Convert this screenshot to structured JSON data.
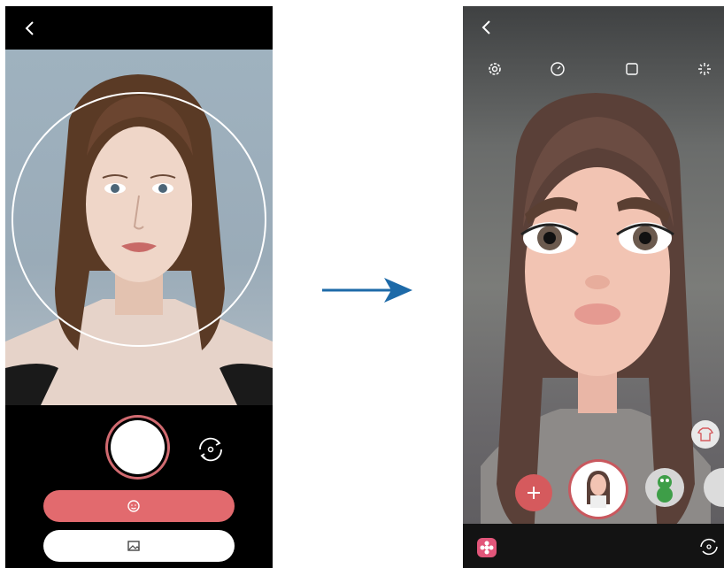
{
  "left_screen": {
    "top_bar": {
      "back_icon": "chevron-left-icon"
    },
    "buttons": {
      "primary": {
        "icon": "face-icon",
        "label": ""
      },
      "secondary": {
        "icon": "gallery-icon",
        "label": ""
      }
    },
    "switch_camera_icon": "switch-camera-icon"
  },
  "right_screen": {
    "top_bar": {
      "back_icon": "chevron-left-icon",
      "icons": [
        "settings-icon",
        "timer-icon",
        "aspect-ratio-icon",
        "effects-icon"
      ]
    },
    "avatar_carousel": [
      "add-emoji-button",
      "selected-emoji",
      "dinosaur-emoji",
      "next-emoji"
    ],
    "bottom_bar": {
      "left_icon": "flower-icon",
      "right_icon": "switch-camera-icon"
    }
  },
  "colors": {
    "accent": "#e26a6e",
    "ring": "#d16a70",
    "arrow": "#1d6aa8"
  }
}
